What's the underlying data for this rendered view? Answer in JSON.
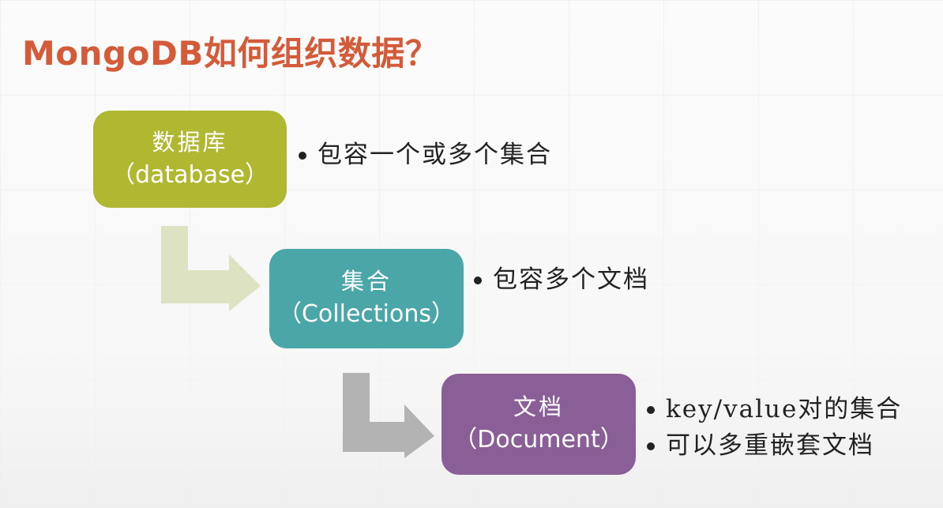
{
  "title": "MongoDB如何组织数据？",
  "colors": {
    "title": "#d35b39",
    "database_box": "#b0b831",
    "collections_box": "#4aa6a7",
    "document_box": "#8a5f97",
    "arrow_1": "#dde2c2",
    "arrow_2": "#b3b3b3"
  },
  "nodes": [
    {
      "label_zh": "数据库",
      "label_en": "（database）",
      "bullets": [
        "包容一个或多个集合"
      ]
    },
    {
      "label_zh": "集合",
      "label_en": "（Collections）",
      "bullets": [
        "包容多个文档"
      ]
    },
    {
      "label_zh": "文档",
      "label_en": "（Document）",
      "bullets": [
        "key/value对的集合",
        "可以多重嵌套文档"
      ]
    }
  ]
}
